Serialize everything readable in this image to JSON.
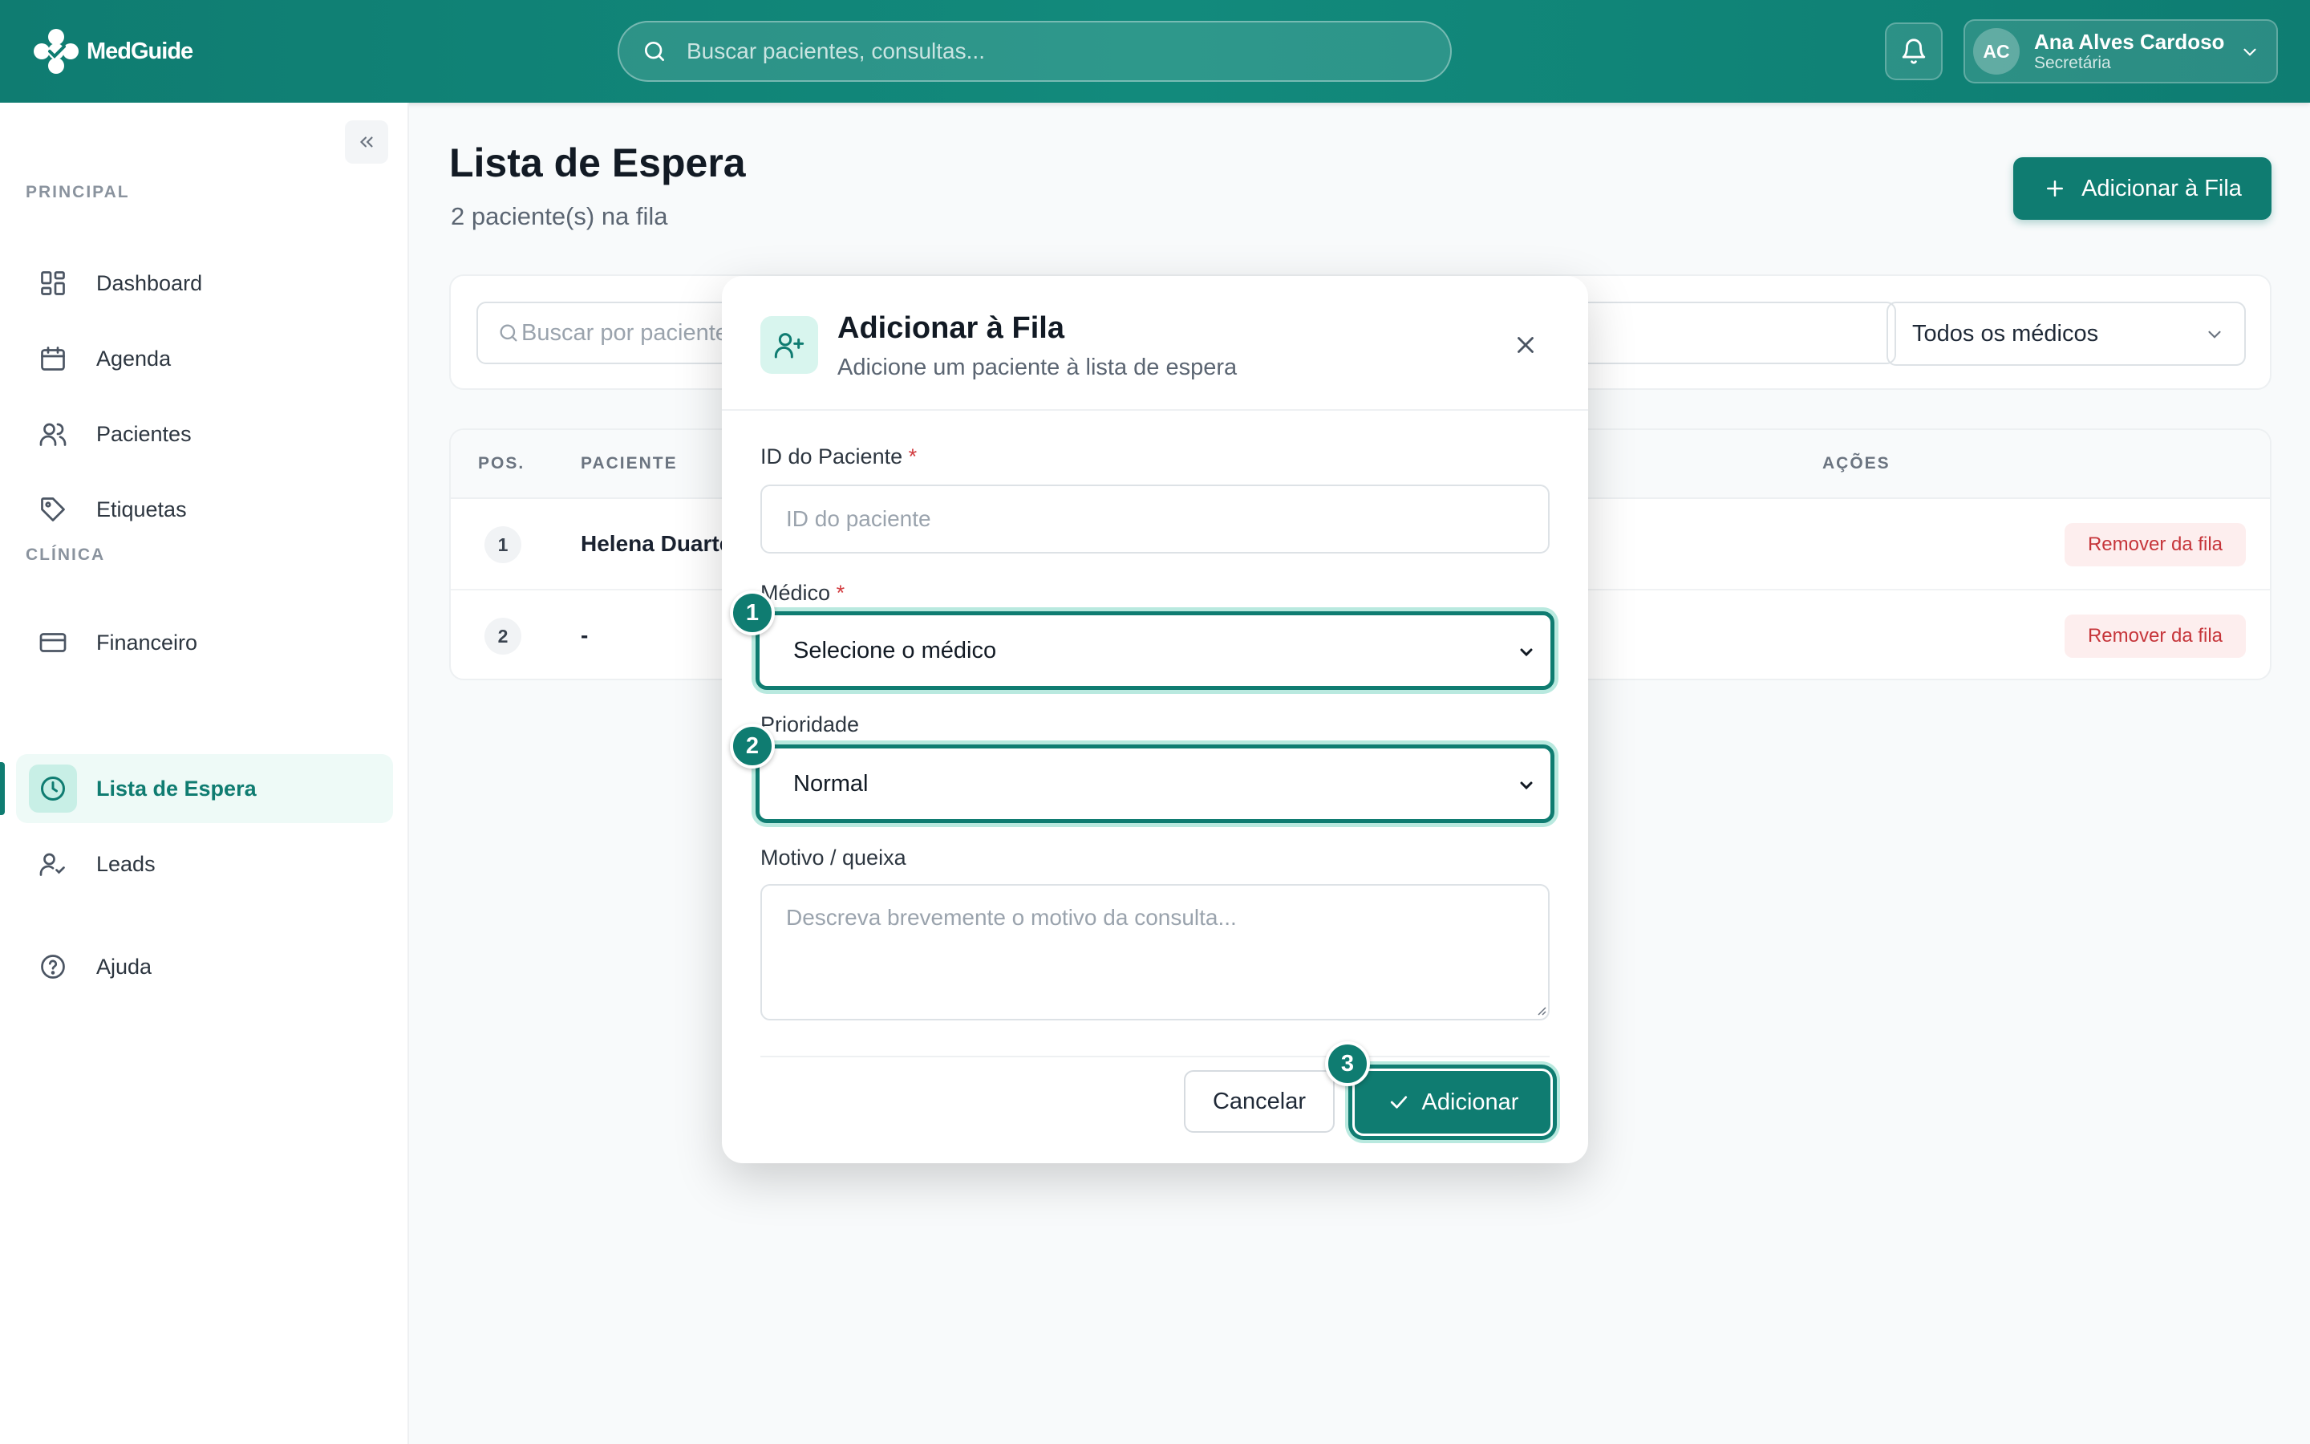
{
  "header": {
    "logo_text": "MedGuide",
    "search_placeholder": "Buscar pacientes, consultas...",
    "user": {
      "initials": "AC",
      "name": "Ana Alves Cardoso",
      "role": "Secretária"
    }
  },
  "sidebar": {
    "sections": [
      {
        "title": "PRINCIPAL"
      },
      {
        "title": "CLÍNICA"
      }
    ],
    "items": [
      {
        "label": "Dashboard",
        "icon": "grid-icon"
      },
      {
        "label": "Agenda",
        "icon": "calendar-icon"
      },
      {
        "label": "Pacientes",
        "icon": "users-icon"
      },
      {
        "label": "Etiquetas",
        "icon": "tag-icon"
      },
      {
        "label": "Financeiro",
        "icon": "credit-card-icon"
      },
      {
        "label": "Lista de Espera",
        "icon": "clock-icon",
        "active": true
      },
      {
        "label": "Leads",
        "icon": "user-check-icon"
      },
      {
        "label": "Ajuda",
        "icon": "help-circle-icon"
      }
    ]
  },
  "main": {
    "title": "Lista de Espera",
    "subtitle": "2 paciente(s) na fila",
    "add_button": "Adicionar à Fila",
    "filter_search_placeholder": "Buscar por paciente",
    "filter_doctor": "Todos os médicos",
    "table": {
      "columns": [
        "POS.",
        "PACIENTE",
        "AÇÕES"
      ],
      "rows": [
        {
          "pos": "1",
          "patient": "Helena Duarte",
          "action": "Remover da fila"
        },
        {
          "pos": "2",
          "patient": "-",
          "action": "Remover da fila"
        }
      ]
    }
  },
  "modal": {
    "title": "Adicionar à Fila",
    "subtitle": "Adicione um paciente à lista de espera",
    "patient_id_label": "ID do Paciente",
    "patient_id_placeholder": "ID do paciente",
    "required_mark": "*",
    "doctor_label": "Médico",
    "doctor_value": "Selecione o médico",
    "priority_label": "Prioridade",
    "priority_value": "Normal",
    "reason_label": "Motivo / queixa",
    "reason_placeholder": "Descreva brevemente o motivo da consulta...",
    "cancel_label": "Cancelar",
    "confirm_label": "Adicionar"
  },
  "annotations": [
    "1",
    "2",
    "3"
  ],
  "colors": {
    "primary": "#0f7c71",
    "danger": "#c6353a",
    "danger_bg": "#fdeeee"
  }
}
